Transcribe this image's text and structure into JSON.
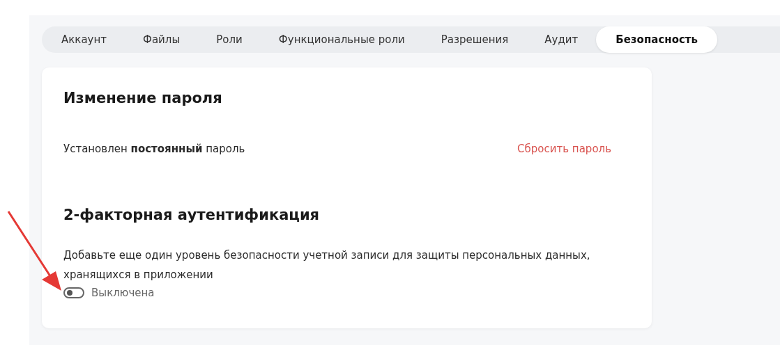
{
  "tabs": [
    {
      "label": "Аккаунт",
      "selected": false
    },
    {
      "label": "Файлы",
      "selected": false
    },
    {
      "label": "Роли",
      "selected": false
    },
    {
      "label": "Функциональные роли",
      "selected": false
    },
    {
      "label": "Разрешения",
      "selected": false
    },
    {
      "label": "Аудит",
      "selected": false
    },
    {
      "label": "Безопасность",
      "selected": true
    }
  ],
  "password": {
    "title": "Изменение пароля",
    "status": "Установлен **постоянный** пароль",
    "reset_link": "Сбросить пароль"
  },
  "two_factor": {
    "title": "2-факторная аутентификация",
    "description": "Добавьте еще один уровень безопасности учетной записи для защиты персональных данных, хранящихся в приложении",
    "toggle": {
      "on": false,
      "label": "Выключена"
    }
  }
}
